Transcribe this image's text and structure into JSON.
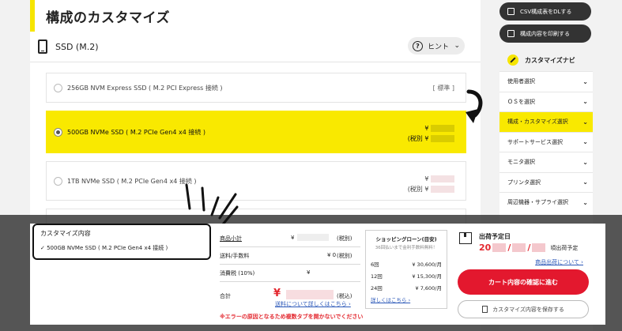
{
  "page": {
    "title": "構成のカスタマイズ"
  },
  "category": {
    "title": "SSD (M.2)",
    "hint_label": "ヒント",
    "hint_glyph": "?"
  },
  "options": [
    {
      "label": "256GB NVM Express SSD ( M.2 PCI Express 接続 )",
      "badge": "[ 標準 ]",
      "selected": false
    },
    {
      "label": "500GB NVMe SSD ( M.2 PCIe Gen4 x4 接続 )",
      "price_yen": "¥",
      "price_tax": "(税別 ¥",
      "selected": true
    },
    {
      "label": "1TB NVMe SSD ( M.2 PCIe Gen4 x4 接続 )",
      "price_yen": "¥",
      "price_tax": "(税別 ¥",
      "selected": false
    }
  ],
  "sidebar": {
    "csv_button": "CSV構成表をDLする",
    "print_button": "構成内容を印刷する",
    "navi_title": "カスタマイズナビ",
    "items": [
      {
        "label": "使用者選択",
        "active": false
      },
      {
        "label": "ＯＳを選択",
        "active": false
      },
      {
        "label": "構成・カスタマイズ選択",
        "active": true
      },
      {
        "label": "サポートサービス選択",
        "active": false
      },
      {
        "label": "モニタ選択",
        "active": false
      },
      {
        "label": "プリンタ選択",
        "active": false
      },
      {
        "label": "周辺機器・サプライ選択",
        "active": false
      }
    ],
    "chevron": "⌄"
  },
  "summary": {
    "title": "カスタマイズ内容",
    "item": "✓ 500GB NVMe SSD ( M.2 PCIe Gen4 x4 接続 )"
  },
  "totals": {
    "subtotal_label": "商品小計",
    "subtotal_yen": "¥",
    "subtotal_note": "(税別)",
    "shipping_label": "送料/手数料",
    "shipping_value": "¥ 0",
    "shipping_note": "(税別)",
    "tax_label": "消費税 (10%)",
    "tax_yen": "¥",
    "total_label": "合計",
    "total_yen": "¥",
    "total_note": "(税込)",
    "shipping_link": "送料について詳しくはこちら ›",
    "error_note": "※エラーの原因となるため複数タブを開かないでください"
  },
  "loan": {
    "title": "ショッピングローン(目安)",
    "subtitle": "36回払いまで金利手数料無料！",
    "rows": [
      {
        "n": "6回",
        "p": "¥ 30,600/月"
      },
      {
        "n": "12回",
        "p": "¥ 15,300/月"
      },
      {
        "n": "24回",
        "p": "¥ 7,600/月"
      }
    ],
    "link": "詳しくはこちら ›"
  },
  "shipping": {
    "label": "出荷予定日",
    "date_prefix": "20",
    "date_sep": "/",
    "date_suffix": "頃出荷予定",
    "product_link": "商品出荷について ›",
    "cart_button": "カート内容の確認に進む",
    "save_button": "カスタマイズ内容を保存する"
  },
  "colors": {
    "accent_yellow": "#f9e900",
    "cta_red": "#e3182e",
    "link_blue": "#2a57b8"
  }
}
